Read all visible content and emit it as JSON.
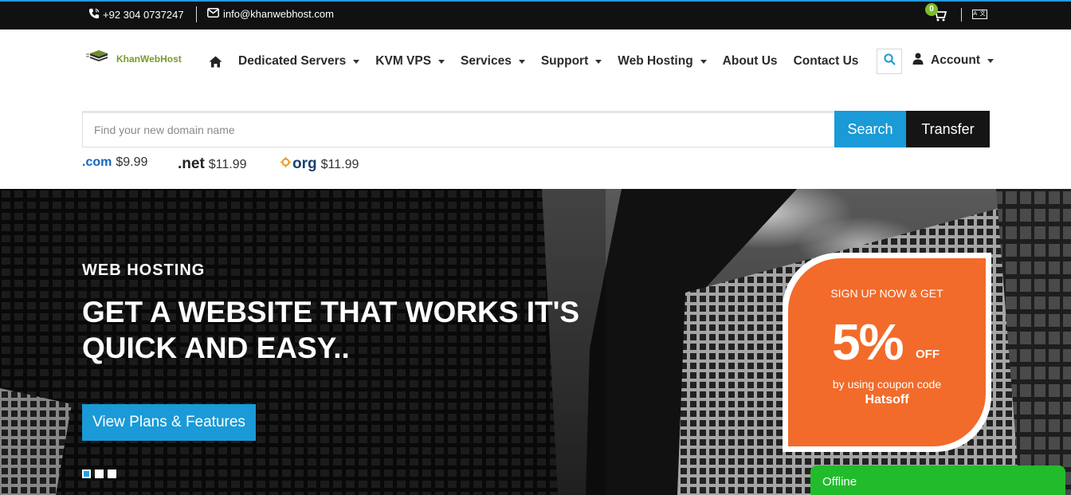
{
  "topbar": {
    "phone": "+92 304 0737247",
    "email": "info@khanwebhost.com",
    "cart_count": "0",
    "lang_label": "A 文"
  },
  "header": {
    "logo_text": "KhanWebHost",
    "nav": [
      {
        "label": "Dedicated Servers",
        "dropdown": true
      },
      {
        "label": "KVM VPS",
        "dropdown": true
      },
      {
        "label": "Services",
        "dropdown": true
      },
      {
        "label": "Support",
        "dropdown": true
      },
      {
        "label": "Web Hosting",
        "dropdown": true
      },
      {
        "label": "About Us",
        "dropdown": false
      },
      {
        "label": "Contact Us",
        "dropdown": false
      }
    ],
    "account_label": "Account"
  },
  "domain_search": {
    "placeholder": "Find your new domain name",
    "search_label": "Search",
    "transfer_label": "Transfer",
    "tlds": [
      {
        "name": ".com",
        "price": "$9.99"
      },
      {
        "name": ".net",
        "price": "$11.99"
      },
      {
        "name": "org",
        "price": "$11.99"
      }
    ]
  },
  "hero": {
    "eyebrow": "WEB HOSTING",
    "headline": "GET A WEBSITE THAT WORKS IT'S QUICK AND EASY..",
    "cta_label": "View Plans & Features",
    "slide_count": 3,
    "active_slide": 1
  },
  "promo": {
    "line1": "SIGN UP NOW & GET",
    "percent": "5%",
    "off": "OFF",
    "line2": "by using coupon code",
    "code": "Hatsoff"
  },
  "chat": {
    "status": "Offline"
  },
  "colors": {
    "accent_blue": "#1a9ad6",
    "promo_orange": "#f26b2a",
    "chat_green": "#22bb2c",
    "topbar_black": "#111111",
    "logo_green": "#7a9a2c"
  }
}
